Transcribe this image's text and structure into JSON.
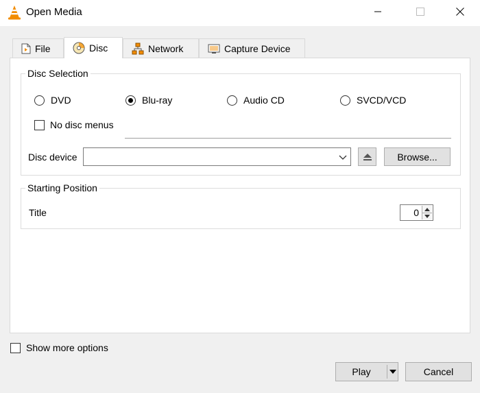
{
  "window": {
    "title": "Open Media",
    "minimize_icon": "minimize-icon",
    "maximize_icon": "maximize-icon",
    "close_icon": "close-icon"
  },
  "tabs": [
    {
      "label": "File",
      "icon": "file-icon",
      "active": false
    },
    {
      "label": "Disc",
      "icon": "disc-icon",
      "active": true
    },
    {
      "label": "Network",
      "icon": "network-icon",
      "active": false
    },
    {
      "label": "Capture Device",
      "icon": "capture-device-icon",
      "active": false
    }
  ],
  "disc_selection": {
    "legend": "Disc Selection",
    "options": [
      {
        "label": "DVD",
        "selected": false
      },
      {
        "label": "Blu-ray",
        "selected": true
      },
      {
        "label": "Audio CD",
        "selected": false
      },
      {
        "label": "SVCD/VCD",
        "selected": false
      }
    ],
    "no_disc_menus_label": "No disc menus",
    "no_disc_menus_checked": false,
    "device_label": "Disc device",
    "device_value": "",
    "browse_label": "Browse..."
  },
  "starting_position": {
    "legend": "Starting Position",
    "title_label": "Title",
    "title_value": "0"
  },
  "footer": {
    "show_more_label": "Show more options",
    "show_more_checked": false,
    "play_label": "Play",
    "cancel_label": "Cancel"
  },
  "colors": {
    "window_bg": "#f0f0f0",
    "page_bg": "#ffffff",
    "button_bg": "#e1e1e1",
    "vlc_orange": "#f28c00"
  }
}
